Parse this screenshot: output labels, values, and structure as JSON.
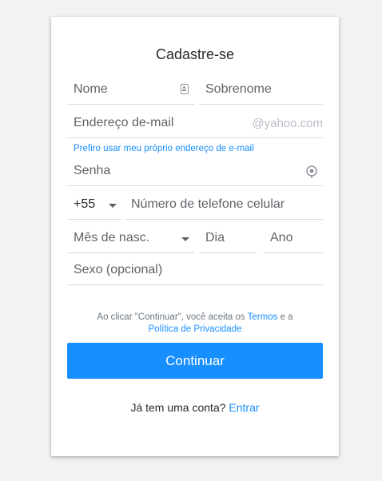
{
  "form": {
    "title": "Cadastre-se",
    "first_name_placeholder": "Nome",
    "last_name_placeholder": "Sobrenome",
    "email_placeholder": "Endereço de-mail",
    "email_domain": "@yahoo.com",
    "own_email_link": "Prefiro usar meu próprio endereço de e-mail",
    "password_placeholder": "Senha",
    "country_code": "+55",
    "phone_placeholder": "Número de telefone celular",
    "birth_month_placeholder": "Mês de nasc.",
    "birth_day_placeholder": "Dia",
    "birth_year_placeholder": "Ano",
    "gender_placeholder": "Sexo (opcional)"
  },
  "terms": {
    "prefix": "Ao clicar \"Continuar\", você aceita os",
    "terms_link": "Termos",
    "conjunction": "e a",
    "privacy_link": "Política de Privacidade"
  },
  "continue_label": "Continuar",
  "signin": {
    "prompt": "Já tem uma conta?",
    "link": "Entrar"
  },
  "colors": {
    "accent": "#188fff",
    "background": "#f2f2f2",
    "card": "#ffffff"
  }
}
